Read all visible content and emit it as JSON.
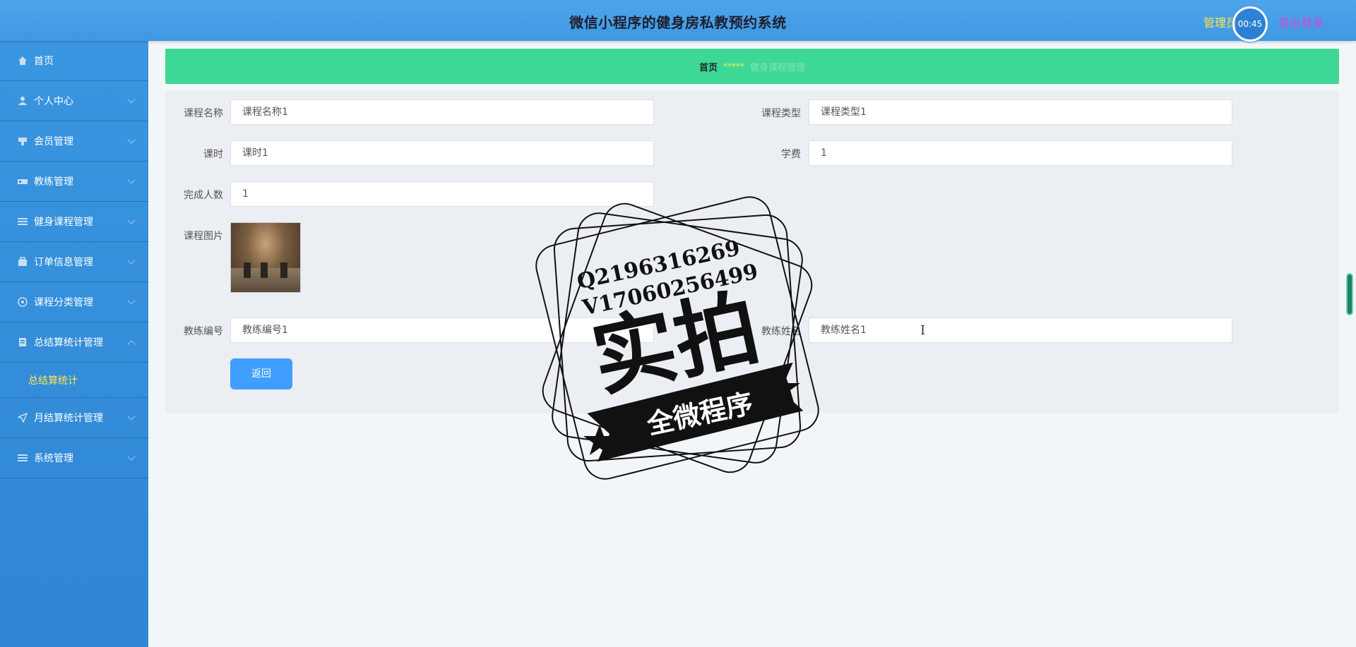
{
  "header": {
    "title": "微信小程序的健身房私教预约系统",
    "admin_label": "管理员",
    "logout_label": "退出登录",
    "timer": "00:45"
  },
  "sidebar": {
    "items": [
      {
        "label": "首页",
        "icon": "home-icon"
      },
      {
        "label": "个人中心",
        "icon": "user-icon"
      },
      {
        "label": "会员管理",
        "icon": "member-icon"
      },
      {
        "label": "教练管理",
        "icon": "coach-icon"
      },
      {
        "label": "健身课程管理",
        "icon": "list-icon"
      },
      {
        "label": "订单信息管理",
        "icon": "briefcase-icon"
      },
      {
        "label": "课程分类管理",
        "icon": "category-icon"
      },
      {
        "label": "总结算统计管理",
        "icon": "document-icon"
      },
      {
        "label": "月结算统计管理",
        "icon": "send-icon"
      },
      {
        "label": "系统管理",
        "icon": "list-icon"
      }
    ],
    "active_sub": "总结算统计"
  },
  "breadcrumb": {
    "home": "首页",
    "sep": "*****",
    "current": "健身课程管理"
  },
  "form": {
    "course_name_label": "课程名称",
    "course_name_value": "课程名称1",
    "course_type_label": "课程类型",
    "course_type_value": "课程类型1",
    "hours_label": "课时",
    "hours_value": "课时1",
    "fee_label": "学费",
    "fee_value": "1",
    "completed_label": "完成人数",
    "completed_value": "1",
    "image_label": "课程图片",
    "coach_id_label": "教练编号",
    "coach_id_value": "教练编号1",
    "coach_name_label": "教练姓名",
    "coach_name_value": "教练姓名1",
    "return_label": "返回"
  },
  "watermark": {
    "line1": "Q2196316269",
    "line2": "V17060256499",
    "big": "实拍",
    "banner": "全微程序"
  }
}
